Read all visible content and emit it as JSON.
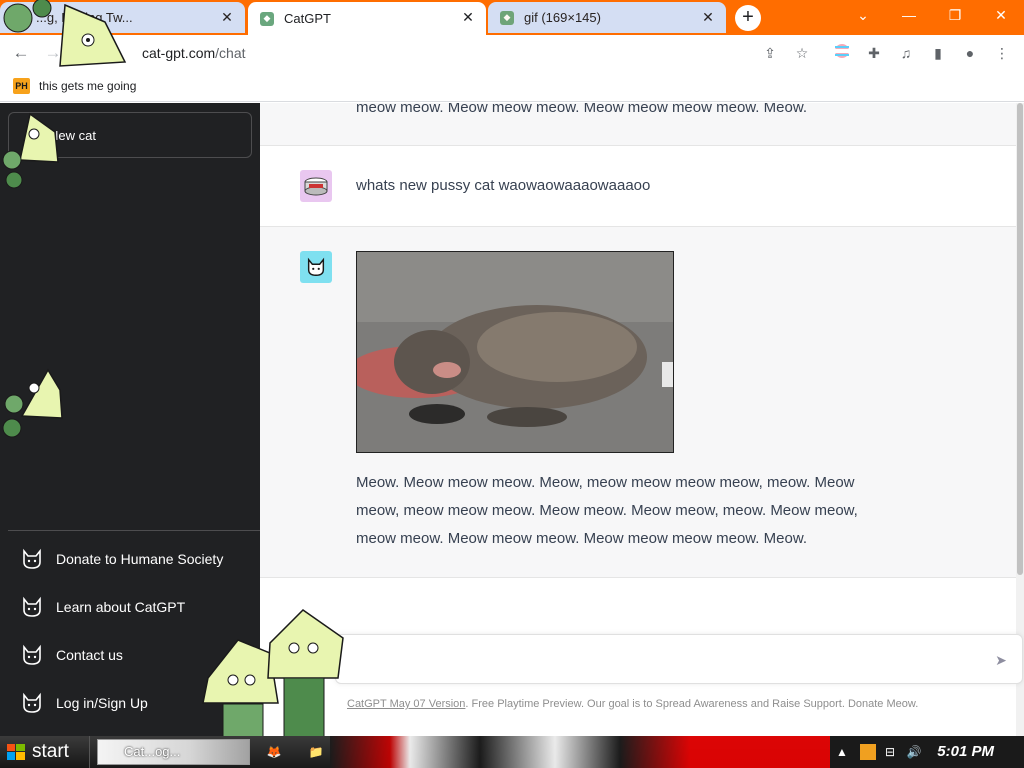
{
  "browser": {
    "tabs": [
      {
        "title": "...g, Darling Tw...",
        "active": false
      },
      {
        "title": "CatGPT",
        "active": true
      },
      {
        "title": "gif (169×145)",
        "active": false
      }
    ],
    "url_host": "cat-gpt.com",
    "url_path": "/chat",
    "bookmark": {
      "icon": "PH",
      "label": "this gets me going"
    }
  },
  "sidebar": {
    "new_cat_label": "New cat",
    "items": [
      {
        "label": "Donate to Humane Society"
      },
      {
        "label": "Learn about CatGPT"
      },
      {
        "label": "Contact us"
      },
      {
        "label": "Log in/Sign Up"
      }
    ]
  },
  "chat": {
    "messages": [
      {
        "role": "assistant",
        "text": "meow meow. Meow meow meow. Meow meow meow meow. Meow."
      },
      {
        "role": "user",
        "text": "whats new pussy cat waowaowaaaowaaaoo"
      },
      {
        "role": "assistant",
        "text": "Meow. Meow meow meow. Meow, meow meow meow meow, meow. Meow meow, meow meow meow. Meow meow. Meow meow, meow. Meow meow, meow meow. Meow meow meow. Meow meow meow meow. Meow."
      }
    ],
    "input_placeholder": "",
    "footer_link": "CatGPT May 07 Version",
    "footer_text": ". Free Playtime Preview. Our goal is to Spread Awareness and Raise Support. Donate Meow."
  },
  "taskbar": {
    "start_label": "start",
    "task_label": "Cat...og...",
    "clock": "5:01 PM"
  },
  "colors": {
    "tab_strip": "#ff6d00",
    "sidebar_bg": "#202123",
    "user_avatar": "#e9c7f0",
    "bot_avatar": "#7fe0f0"
  }
}
